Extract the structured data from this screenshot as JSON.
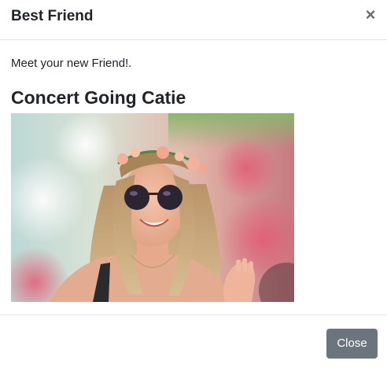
{
  "modal": {
    "title": "Best Friend",
    "close_glyph": "×",
    "intro_text": "Meet your new Friend!.",
    "heading": "Concert Going Catie",
    "photo_icon": "photo-of-smiling-woman-at-concert",
    "close_button_label": "Close"
  },
  "colors": {
    "button_bg": "#6c757d",
    "divider": "#e3e6ea"
  }
}
